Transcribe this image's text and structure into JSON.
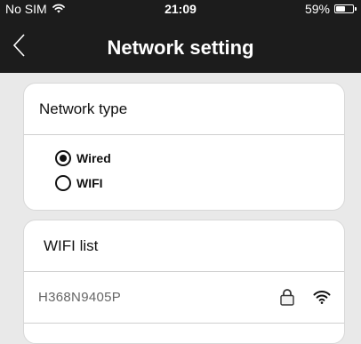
{
  "status_bar": {
    "carrier": "No SIM",
    "time": "21:09",
    "battery_percent": "59%",
    "battery_level": 0.59
  },
  "nav": {
    "back_icon": "chevron-left-icon",
    "title": "Network setting"
  },
  "network_type": {
    "header": "Network type",
    "options": [
      {
        "label": "Wired",
        "selected": true
      },
      {
        "label": "WIFI",
        "selected": false
      }
    ]
  },
  "wifi_list": {
    "header": "WIFI list",
    "networks": [
      {
        "ssid": "H368N9405P",
        "secured": true,
        "icons": [
          "lock-icon",
          "wifi-signal-icon"
        ]
      }
    ]
  },
  "colors": {
    "bar_background": "#1c1c1c",
    "page_background": "#e9e9e9",
    "card_background": "#ffffff",
    "divider": "#cfcfcf",
    "ssid_text": "#666666"
  }
}
